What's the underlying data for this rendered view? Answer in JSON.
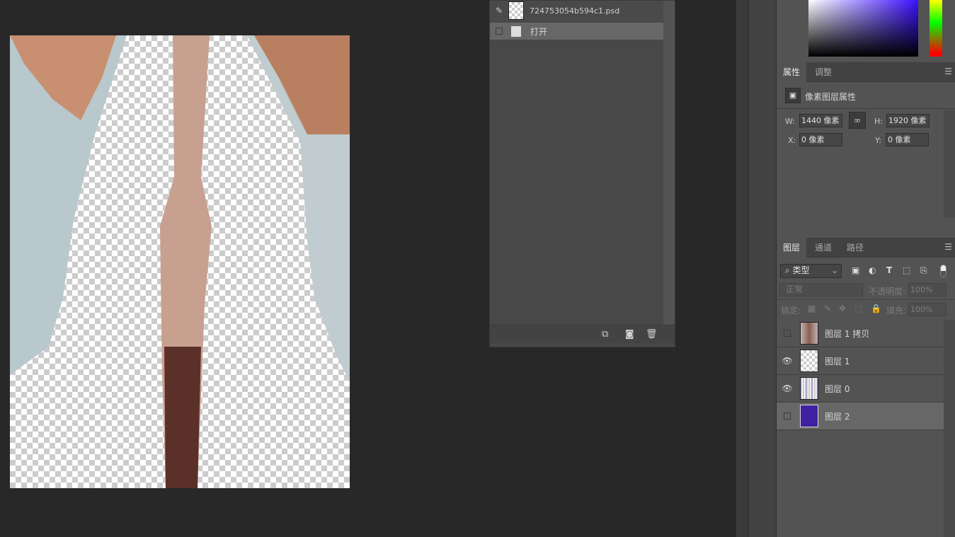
{
  "history": {
    "snapshot_name": "724753054b594c1.psd",
    "items": [
      {
        "label": "打开"
      }
    ]
  },
  "properties": {
    "tabs": [
      "属性",
      "调整"
    ],
    "title": "像素图层属性",
    "w_label": "W:",
    "w_value": "1440 像素",
    "h_label": "H:",
    "h_value": "1920 像素",
    "x_label": "X:",
    "x_value": "0 像素",
    "y_label": "Y:",
    "y_value": "0 像素"
  },
  "layers_panel": {
    "tabs": [
      "图层",
      "通道",
      "路径"
    ],
    "filter": "类型",
    "blend_mode": "正常",
    "opacity_label": "不透明度:",
    "opacity": "100%",
    "lock_label": "锁定:",
    "fill_label": "填充:",
    "fill": "100%",
    "layers": [
      {
        "name": "图层 1 拷贝",
        "visible": false
      },
      {
        "name": "图层 1",
        "visible": true
      },
      {
        "name": "图层 0",
        "visible": true
      },
      {
        "name": "图层 2",
        "visible": false,
        "selected": true,
        "color": "#4020a0"
      }
    ]
  }
}
